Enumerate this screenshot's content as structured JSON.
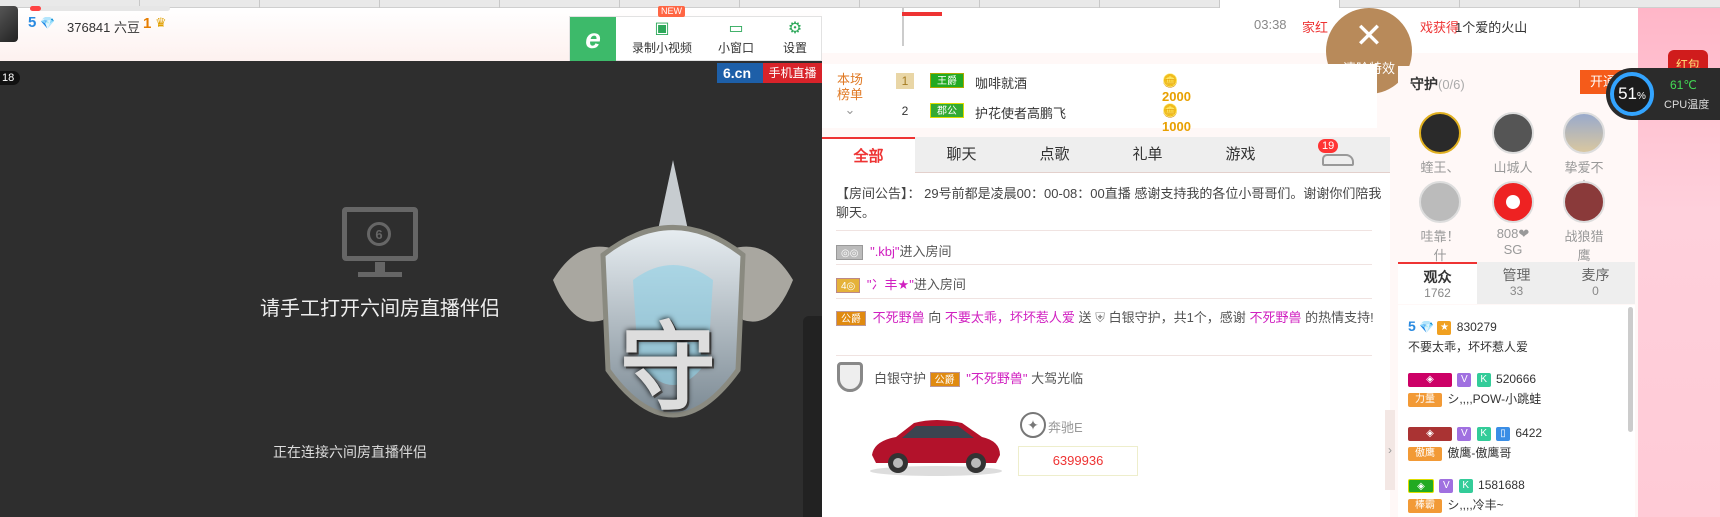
{
  "header": {
    "rich_level": "5",
    "beans": "376841 六豆",
    "charm_level": "1"
  },
  "toolbar": {
    "new_badge": "NEW",
    "record_video": "录制小视频",
    "mini_window": "小窗口",
    "settings": "设置"
  },
  "video": {
    "time_badge": "18",
    "logo": "6.cn",
    "logo_sub": "手机直播",
    "monitor_num": "6",
    "open_message": "请手工打开六间房直播伴侣",
    "connecting_message": "正在连接六间房直播伴侣",
    "emblem_char": "守"
  },
  "top_notice": {
    "time": "03:38",
    "text_red": "家红",
    "text_red2": "戏获得",
    "text": "1个爱的火山"
  },
  "clear_effects": {
    "label": "清除特效"
  },
  "rank": {
    "label": "本场榜单",
    "rows": [
      {
        "num": "1",
        "badge": "王爵",
        "name": "咖啡就酒",
        "score": "2000"
      },
      {
        "num": "2",
        "badge": "郡公",
        "name": "护花使者高鹏飞",
        "score": "1000"
      }
    ]
  },
  "chat_tabs": [
    "全部",
    "聊天",
    "点歌",
    "礼单",
    "游戏"
  ],
  "car_badge": "19",
  "chat": {
    "announcement": "【房间公告】： 29号前都是凌晨00：00-08：00直播 感谢支持我的各位小哥哥们。谢谢你们陪我聊天。",
    "enter1_name": "\".kbj\"",
    "enter1_text": "进入房间",
    "enter2_name": "\"冫丰★\"",
    "enter2_text": "进入房间",
    "gift_user": "不死野兽",
    "gift_to": "向",
    "gift_target": "不要太乖，坏坏惹人爱",
    "gift_send": "送",
    "gift_item": "白银守护，共1个，感谢",
    "gift_thanks_user": "不死野兽",
    "gift_thanks": "的热情支持!",
    "guard_label": "白银守护",
    "guard_user": "\"不死野兽\"",
    "guard_arrive": "大驾光临",
    "car_name": "奔驰E",
    "car_id": "6399936",
    "badge_gong": "公爵"
  },
  "guard": {
    "title": "守护",
    "count": "(0/6)",
    "open_label": "开通",
    "members": [
      "蝰王、",
      "山城人",
      "挚爱不太",
      "哇靠！什",
      "808❤SG",
      "战狼猎鹰"
    ]
  },
  "audience_tabs": [
    {
      "label": "观众",
      "count": "1762"
    },
    {
      "label": "管理",
      "count": "33"
    },
    {
      "label": "麦序",
      "count": "0"
    }
  ],
  "audience": [
    {
      "level": "5",
      "id": "830279",
      "name": "不要太乖，坏坏惹人爱"
    },
    {
      "badge": "力量",
      "id": "520666",
      "name": "シ,,,,POW-小跳蛙"
    },
    {
      "badge": "傲鹰",
      "id": "6422",
      "name": "傲鹰-傲鹰哥"
    },
    {
      "badge": "棒霸",
      "id": "1581688",
      "name": "シ,,,,冷丰~"
    }
  ],
  "right_edge": {
    "red_packet": "红包",
    "cpu_percent": "51",
    "cpu_percent_sign": "%",
    "cpu_temp": "61℃",
    "cpu_label": "CPU温度"
  },
  "colors": {
    "accent": "#e33333",
    "toolbar_green": "#3dba6a",
    "clear_fx": "#b88a5a",
    "cpu_ring": "#33a4ff"
  }
}
